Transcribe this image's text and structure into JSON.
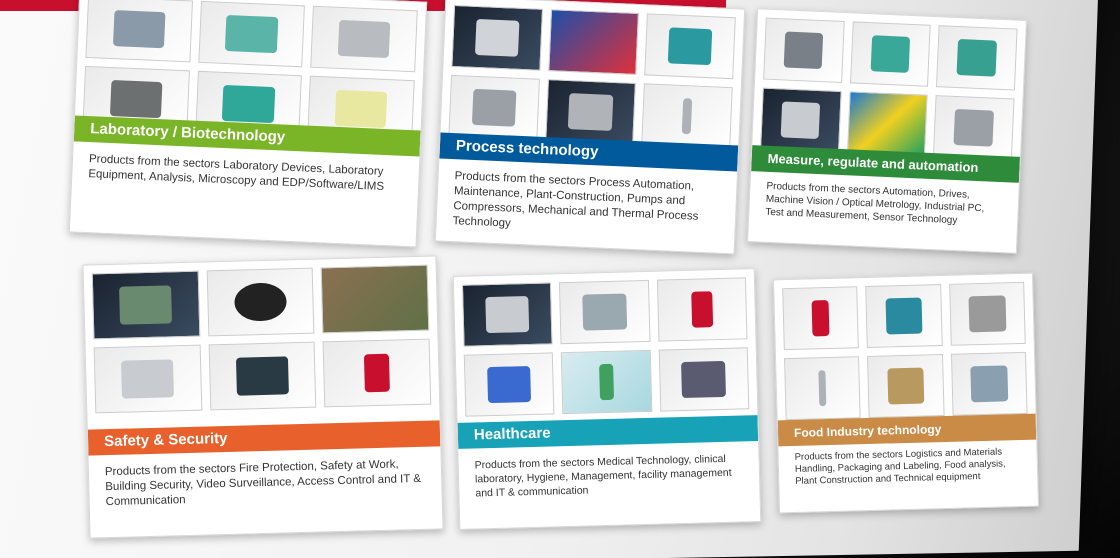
{
  "cards": [
    {
      "title": "Laboratory / Biotechnology",
      "description": "Products from the sectors Laboratory Devices, Laboratory Equipment, Analysis, Microscopy and EDP/Software/LIMS",
      "color": "#7ab427",
      "thumbs": [
        "lab-device",
        "lab-robot",
        "lab-analyzer",
        "lab-conveyor",
        "lab-pipetting-robot",
        "microplate"
      ]
    },
    {
      "title": "Process technology",
      "description": "Products from the sectors Process Automation, Maintenance, Plant-Construction, Pumps and Compressors, Mechanical and Thermal Process Technology",
      "color": "#005a9c",
      "thumbs": [
        "pump-units",
        "tubing",
        "centrifugal-pump",
        "sieve-tower",
        "gear-pump",
        "sensor-rod"
      ]
    },
    {
      "title": "Measure, regulate and automation",
      "description": "Products from the sectors Automation, Drives, Machine Vision / Optical Metrology, Industrial PC, Test and Measurement, Sensor Technology",
      "color": "#2e8b3a",
      "thumbs": [
        "control-cabinet",
        "automation-frame",
        "test-rig",
        "pump-units",
        "color-sensors",
        "camera"
      ]
    },
    {
      "title": "Safety & Security",
      "description": "Products from the sectors Fire Protection, Safety at Work, Building Security, Video Surveillance, Access Control and IT & Communication",
      "color": "#e8602c",
      "thumbs": [
        "surveillance-monitor",
        "dome-camera",
        "gate",
        "video-software",
        "network-recorder",
        "alarm-beacon"
      ]
    },
    {
      "title": "Healthcare",
      "description": "Products from the sectors Medical Technology, clinical laboratory, Hygiene, Management, facility management and IT & communication",
      "color": "#17a2b8",
      "thumbs": [
        "pump-units",
        "peristaltic-pump",
        "alarm-beacon",
        "syringe-pump",
        "wireless-sensor",
        "analyzer-box"
      ]
    },
    {
      "title": "Food Industry technology",
      "description": "Products from the sectors Logistics and Materials Handling, Packaging and Labeling, Food analysis, Plant Construction and Technical equipment",
      "color": "#c98b45",
      "thumbs": [
        "alarm-beacon",
        "centrifugal-pump",
        "gear-unit",
        "sensor-rod",
        "valve",
        "filling-machine"
      ]
    }
  ]
}
